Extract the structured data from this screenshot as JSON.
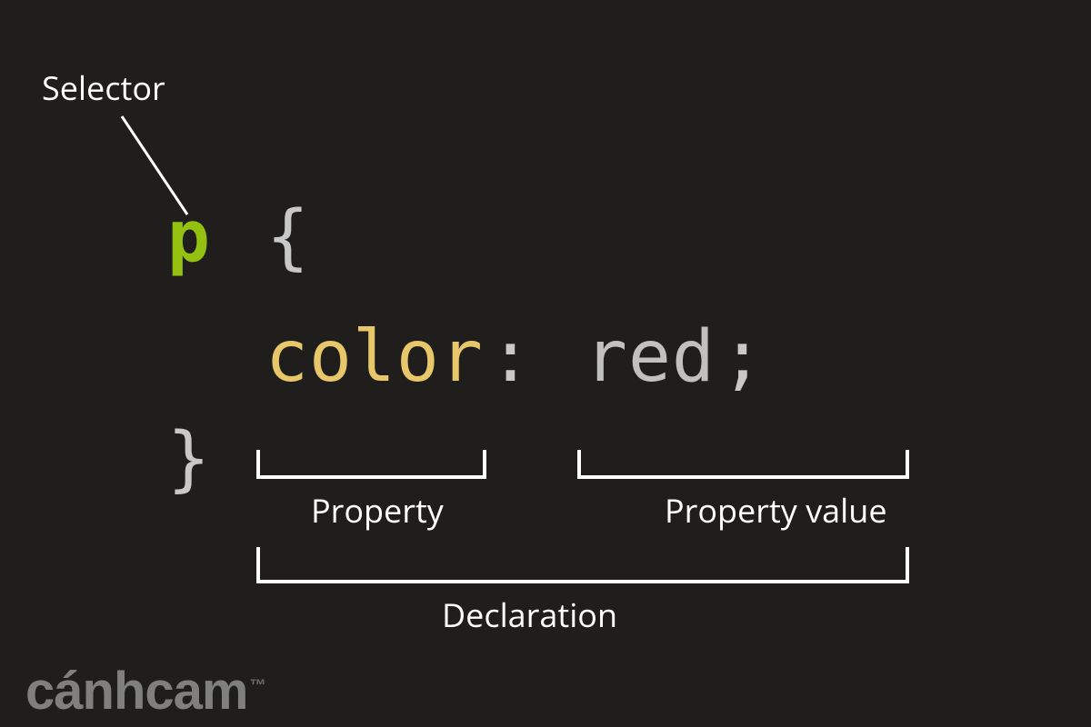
{
  "labels": {
    "selector": "Selector",
    "property": "Property",
    "property_value": "Property value",
    "declaration": "Declaration"
  },
  "code": {
    "selector": "p",
    "open_brace": "{",
    "property": "color",
    "colon": ":",
    "value": "red",
    "semicolon": ";",
    "close_brace": "}"
  },
  "watermark": {
    "text": "cánhcam",
    "suffix": "™"
  },
  "colors": {
    "background": "#1f1e1c",
    "label": "#ffffff",
    "selector_token": "#94c110",
    "property_token": "#e8c66a",
    "punct_token": "#c8c8c8",
    "watermark": "#8a8a88"
  }
}
